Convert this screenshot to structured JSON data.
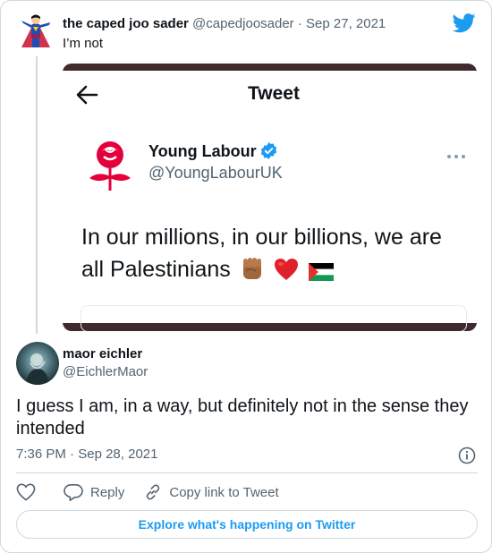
{
  "parent_tweet": {
    "display_name": "the caped joo sader",
    "handle": "@capedjoosader",
    "separator": "·",
    "date": "Sep 27, 2021",
    "text": "I’m not",
    "avatar_icon": "superman-avatar-icon"
  },
  "embedded_screenshot": {
    "header_title": "Tweet",
    "back_icon": "arrow-left-icon",
    "account_name": "Young Labour",
    "account_handle": "@YoungLabourUK",
    "verified_icon": "verified-badge-icon",
    "more_icon": "more-dots-icon",
    "logo_icon": "red-rose-logo-icon",
    "body_line1": "In our millions, in our billions, we are",
    "body_line2": "all Palestinians",
    "emojis": [
      "raised-fist-icon",
      "red-heart-icon",
      "palestine-flag-icon"
    ]
  },
  "main_tweet": {
    "display_name": "maor eichler",
    "handle": "@EichlerMaor",
    "text": "I guess I am, in a way, but definitely not in the sense they intended",
    "time": "7:36 PM",
    "separator": "·",
    "date": "Sep 28, 2021"
  },
  "actions": {
    "like_icon": "heart-icon",
    "reply_label": "Reply",
    "copy_link_label": "Copy link to Tweet"
  },
  "explore_label": "Explore what's happening on Twitter",
  "colors": {
    "twitter_blue": "#1d9bf0",
    "text_primary": "#0f1419",
    "text_secondary": "#536471",
    "border": "#cfd9de",
    "labour_red": "#e4003b"
  }
}
